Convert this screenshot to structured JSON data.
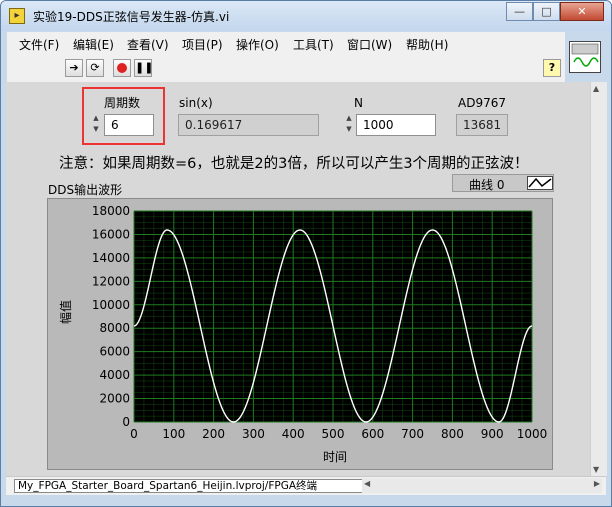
{
  "window": {
    "title": "实验19-DDS正弦信号发生器-仿真.vi",
    "min_label": "—",
    "max_label": "□",
    "close_label": "✕"
  },
  "menu": [
    "文件(F)",
    "编辑(E)",
    "查看(V)",
    "项目(P)",
    "操作(O)",
    "工具(T)",
    "窗口(W)",
    "帮助(H)"
  ],
  "toolbar": {
    "run_icon": "run-arrow-icon",
    "run_continuous_icon": "run-continuous-icon",
    "abort_icon": "abort-stop-icon",
    "pause_icon": "pause-icon",
    "help_label": "?"
  },
  "controls": {
    "period": {
      "label": "周期数",
      "value": "6"
    },
    "sin": {
      "label": "sin(x)",
      "value": "0.169617"
    },
    "n": {
      "label": "N",
      "value": "1000"
    },
    "ad9767": {
      "label": "AD9767",
      "value": "13681"
    }
  },
  "note": "注意：如果周期数=6，也就是2的3倍，所以可以产生3个周期的正弦波！",
  "graph": {
    "legend_label": "曲线 0",
    "colors": {
      "plot_bg": "#000000",
      "grid": "#1f7a1f",
      "trace": "#ffffff"
    }
  },
  "chart_data": {
    "type": "line",
    "title": "DDS输出波形",
    "xlabel": "时间",
    "ylabel": "幅值",
    "xlim": [
      0,
      1000
    ],
    "ylim": [
      0,
      18000
    ],
    "x_ticks": [
      0,
      100,
      200,
      300,
      400,
      500,
      600,
      700,
      800,
      900,
      1000
    ],
    "y_ticks": [
      0,
      2000,
      4000,
      6000,
      8000,
      10000,
      12000,
      14000,
      16000,
      18000
    ],
    "grid": true,
    "series": [
      {
        "name": "曲线 0",
        "x": [
          0,
          83,
          250,
          417,
          583,
          750,
          917,
          1000
        ],
        "values": [
          8191,
          16383,
          0,
          16383,
          0,
          16383,
          0,
          8191
        ]
      }
    ]
  },
  "statusbar": {
    "path": "My_FPGA_Starter_Board_Spartan6_Heijin.lvproj/FPGA终端"
  }
}
